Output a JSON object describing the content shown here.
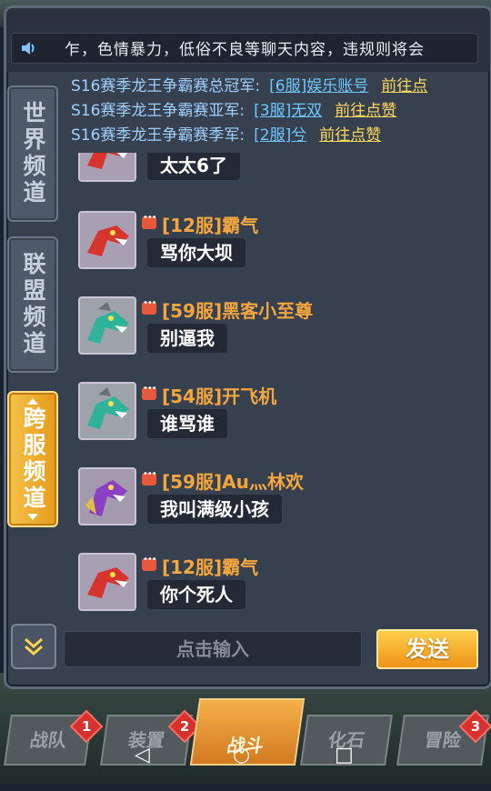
{
  "notice": {
    "icon": "speaker-icon",
    "text": "乍，色情暴力，低俗不良等聊天内容，违规则将会"
  },
  "champions": [
    {
      "label": "S16赛季龙王争霸赛总冠军:",
      "winner": "[6服]娱乐账号",
      "like": "前往点"
    },
    {
      "label": "S16赛季龙王争霸赛亚军:",
      "winner": "[3服]无双",
      "like": "前往点赞"
    },
    {
      "label": "S16赛季龙王争霸赛季军:",
      "winner": "[2服]兮",
      "like": "前往点赞"
    }
  ],
  "tabs": [
    {
      "label": "世界频道",
      "active": false
    },
    {
      "label": "联盟频道",
      "active": false
    },
    {
      "label": "跨服频道",
      "active": true
    }
  ],
  "messages": [
    {
      "name": "",
      "text": "太太6了",
      "avatar": "red-dragon"
    },
    {
      "name": "[12服]霸气",
      "text": "骂你大坝",
      "avatar": "red-dragon"
    },
    {
      "name": "[59服]黑客小至尊",
      "text": "别逼我",
      "avatar": "teal-dragon"
    },
    {
      "name": "[54服]开飞机",
      "text": "谁骂谁",
      "avatar": "teal-dragon"
    },
    {
      "name": "[59服]Au灬林欢",
      "text": "我叫满级小孩",
      "avatar": "purple-dragon"
    },
    {
      "name": "[12服]霸气",
      "text": "你个死人",
      "avatar": "red-dragon"
    }
  ],
  "input": {
    "placeholder": "点击输入"
  },
  "send_label": "发送",
  "bottom_nav": [
    {
      "label": "战队",
      "badge": "1"
    },
    {
      "label": "装置",
      "badge": "2"
    },
    {
      "label": "战斗",
      "badge": ""
    },
    {
      "label": "化石",
      "badge": ""
    },
    {
      "label": "冒险",
      "badge": "3"
    }
  ],
  "system_nav": {
    "back": "◁",
    "home": "○",
    "recent": "□"
  }
}
